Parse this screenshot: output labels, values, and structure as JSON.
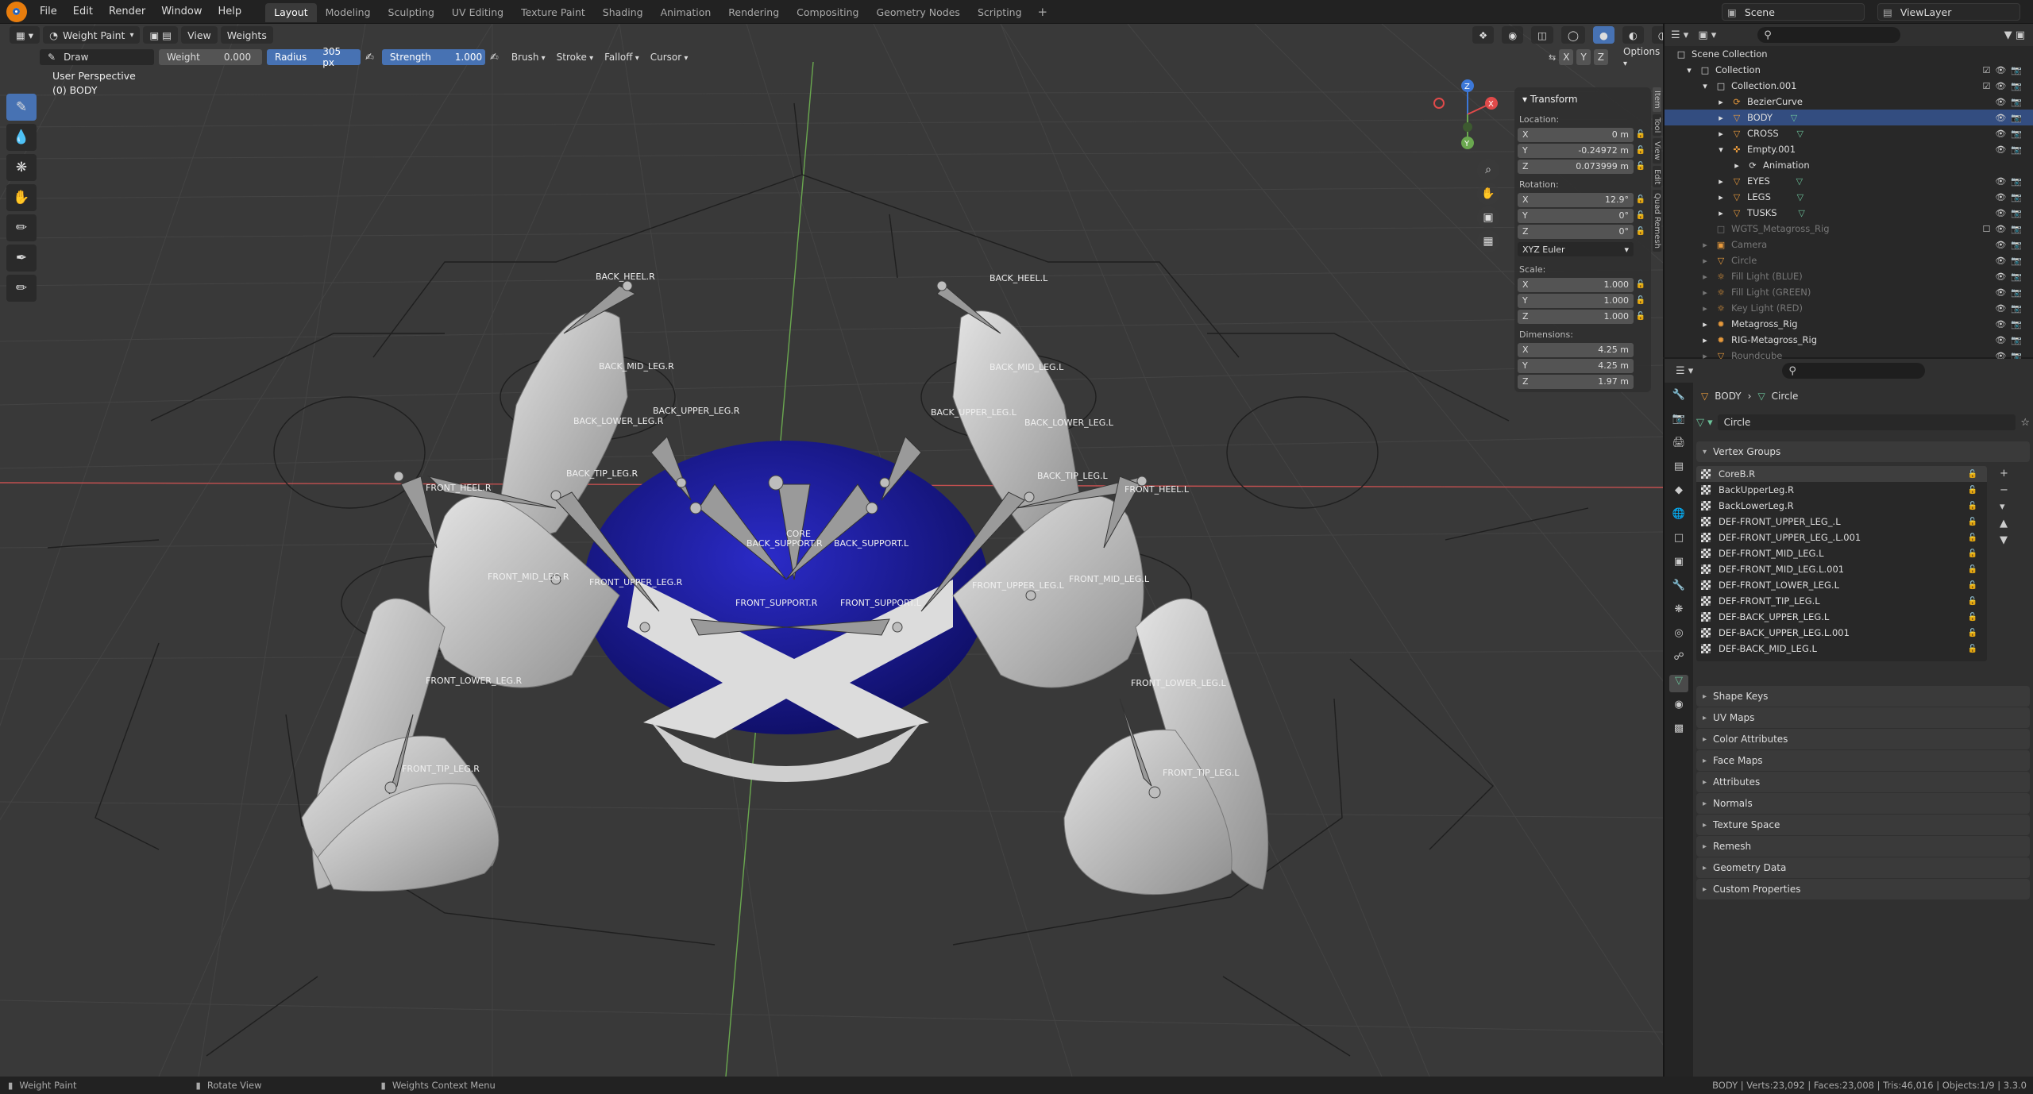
{
  "menu": [
    "File",
    "Edit",
    "Render",
    "Window",
    "Help"
  ],
  "workspaces": [
    "Layout",
    "Modeling",
    "Sculpting",
    "UV Editing",
    "Texture Paint",
    "Shading",
    "Animation",
    "Rendering",
    "Compositing",
    "Geometry Nodes",
    "Scripting"
  ],
  "scene": "Scene",
  "view_layer": "ViewLayer",
  "viewport": {
    "mode": "Weight Paint",
    "menus": [
      "View",
      "Weights"
    ],
    "tool_name": "Draw",
    "weight_label": "Weight",
    "weight_value": "0.000",
    "radius_label": "Radius",
    "radius_value": "305 px",
    "strength_label": "Strength",
    "strength_value": "1.000",
    "dropdowns": [
      "Brush",
      "Stroke",
      "Falloff",
      "Cursor"
    ],
    "options": "Options",
    "perspective": "User Perspective",
    "object_label": "(0) BODY",
    "axis_x": "X",
    "axis_y": "Y",
    "axis_z": "Z"
  },
  "bone_labels": [
    "BACK_HEEL.R",
    "BACK_HEEL.L",
    "BACK_MID_LEG.R",
    "BACK_MID_LEG.L",
    "BACK_UPPER_LEG.R",
    "BACK_UPPER_LEG.L",
    "BACK_LOWER_LEG.R",
    "BACK_LOWER_LEG.L",
    "BACK_TIP_LEG.R",
    "BACK_TIP_LEG.L",
    "FRONT_HEEL.R",
    "FRONT_HEEL.L",
    "CORE",
    "BACK_SUPPORT.R",
    "BACK_SUPPORT.L",
    "FRONT_MID_LEG.R",
    "FRONT_MID_LEG.L",
    "FRONT_UPPER_LEG.R",
    "FRONT_UPPER_LEG.L",
    "FRONT_SUPPORT.R",
    "FRONT_SUPPORT.L",
    "FRONT_LOWER_LEG.R",
    "FRONT_LOWER_LEG.L",
    "FRONT_TIP_LEG.R",
    "FRONT_TIP_LEG.L"
  ],
  "npanel": {
    "title": "Transform",
    "location_label": "Location:",
    "location": [
      [
        "X",
        "0 m"
      ],
      [
        "Y",
        "-0.24972 m"
      ],
      [
        "Z",
        "0.073999 m"
      ]
    ],
    "rotation_label": "Rotation:",
    "rotation": [
      [
        "X",
        "12.9°"
      ],
      [
        "Y",
        "0°"
      ],
      [
        "Z",
        "0°"
      ]
    ],
    "rotation_mode": "XYZ Euler",
    "scale_label": "Scale:",
    "scale": [
      [
        "X",
        "1.000"
      ],
      [
        "Y",
        "1.000"
      ],
      [
        "Z",
        "1.000"
      ]
    ],
    "dimensions_label": "Dimensions:",
    "dimensions": [
      [
        "X",
        "4.25 m"
      ],
      [
        "Y",
        "4.25 m"
      ],
      [
        "Z",
        "1.97 m"
      ]
    ],
    "tabs": [
      "Item",
      "Tool",
      "View",
      "Edit",
      "Quad Remesh"
    ]
  },
  "outliner": {
    "rows": [
      {
        "name": "Scene Collection",
        "indent": 0,
        "dim": false
      },
      {
        "name": "Collection",
        "indent": 1,
        "dim": false
      },
      {
        "name": "Collection.001",
        "indent": 2,
        "dim": false
      },
      {
        "name": "BezierCurve",
        "indent": 3,
        "dim": false
      },
      {
        "name": "BODY",
        "indent": 3,
        "dim": false,
        "selected": true
      },
      {
        "name": "CROSS",
        "indent": 3,
        "dim": false
      },
      {
        "name": "Empty.001",
        "indent": 3,
        "dim": false
      },
      {
        "name": "Animation",
        "indent": 4,
        "dim": false
      },
      {
        "name": "EYES",
        "indent": 3,
        "dim": false
      },
      {
        "name": "LEGS",
        "indent": 3,
        "dim": false
      },
      {
        "name": "TUSKS",
        "indent": 3,
        "dim": false
      },
      {
        "name": "WGTS_Metagross_Rig",
        "indent": 2,
        "dim": true
      },
      {
        "name": "Camera",
        "indent": 2,
        "dim": true
      },
      {
        "name": "Circle",
        "indent": 2,
        "dim": true
      },
      {
        "name": "Fill Light (BLUE)",
        "indent": 2,
        "dim": true
      },
      {
        "name": "Fill Light (GREEN)",
        "indent": 2,
        "dim": true
      },
      {
        "name": "Key Light (RED)",
        "indent": 2,
        "dim": true
      },
      {
        "name": "Metagross_Rig",
        "indent": 2,
        "dim": false
      },
      {
        "name": "RIG-Metagross_Rig",
        "indent": 2,
        "dim": false
      },
      {
        "name": "Roundcube",
        "indent": 2,
        "dim": true
      }
    ]
  },
  "properties": {
    "breadcrumb_object": "BODY",
    "breadcrumb_data": "Circle",
    "data_name": "Circle",
    "vertex_groups_title": "Vertex Groups",
    "vertex_groups": [
      "CoreB.R",
      "BackUpperLeg.R",
      "BackLowerLeg.R",
      "DEF-FRONT_UPPER_LEG_.L",
      "DEF-FRONT_UPPER_LEG_.L.001",
      "DEF-FRONT_MID_LEG.L",
      "DEF-FRONT_MID_LEG.L.001",
      "DEF-FRONT_LOWER_LEG.L",
      "DEF-FRONT_TIP_LEG.L",
      "DEF-BACK_UPPER_LEG.L",
      "DEF-BACK_UPPER_LEG.L.001",
      "DEF-BACK_MID_LEG.L"
    ],
    "sections": [
      "Shape Keys",
      "UV Maps",
      "Color Attributes",
      "Face Maps",
      "Attributes",
      "Normals",
      "Texture Space",
      "Remesh",
      "Geometry Data",
      "Custom Properties"
    ]
  },
  "statusbar": {
    "hint1": "Weight Paint",
    "hint2": "Rotate View",
    "hint3": "Weights Context Menu",
    "stats": "BODY | Verts:23,092 | Faces:23,008 | Tris:46,016 | Objects:1/9 | 3.3.0"
  },
  "colors": {
    "accent": "#4772b3",
    "sphere": "#1a1a9c",
    "x_axis": "#e04a4a",
    "y_axis": "#6aa84f",
    "z_axis": "#3c78d8"
  }
}
